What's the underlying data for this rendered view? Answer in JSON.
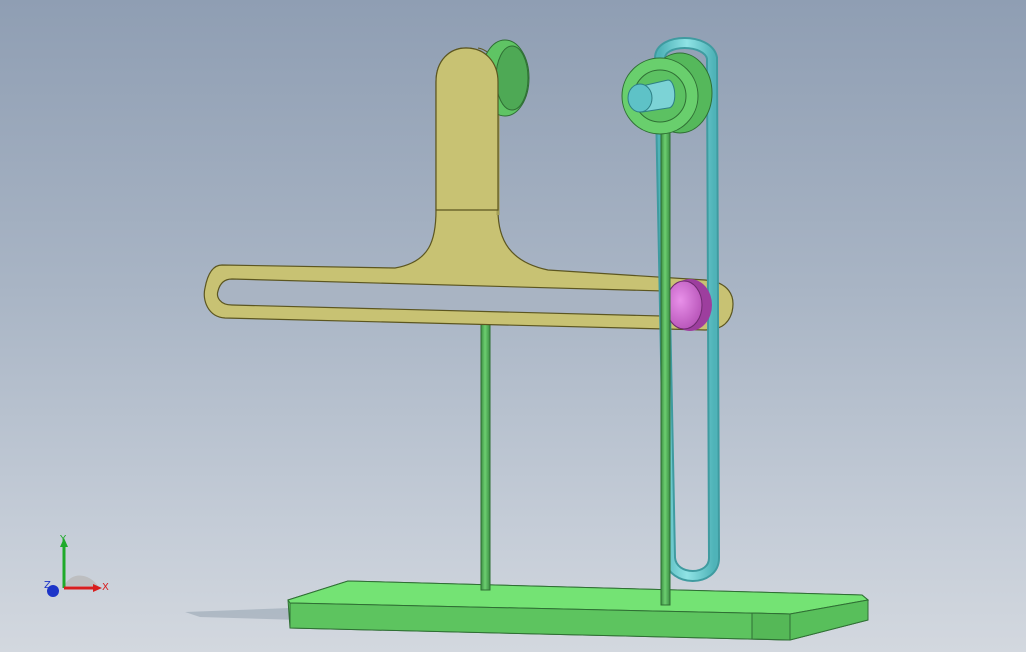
{
  "triad": {
    "x_label": "X",
    "y_label": "Y",
    "z_label": "Z"
  },
  "colors": {
    "background_top": "#8f9eb3",
    "background_bottom": "#d3d8df",
    "base_green": "#6ad86a",
    "rod_green": "#4fae57",
    "arm_yellow": "#c8c273",
    "slot_link_cyan": "#77d6d9",
    "pulley_green": "#69cf6d",
    "pin_magenta": "#d56fd6",
    "axis_x_red": "#d81d1d",
    "axis_y_green": "#1faa2a",
    "axis_z_blue": "#1d35c8"
  }
}
